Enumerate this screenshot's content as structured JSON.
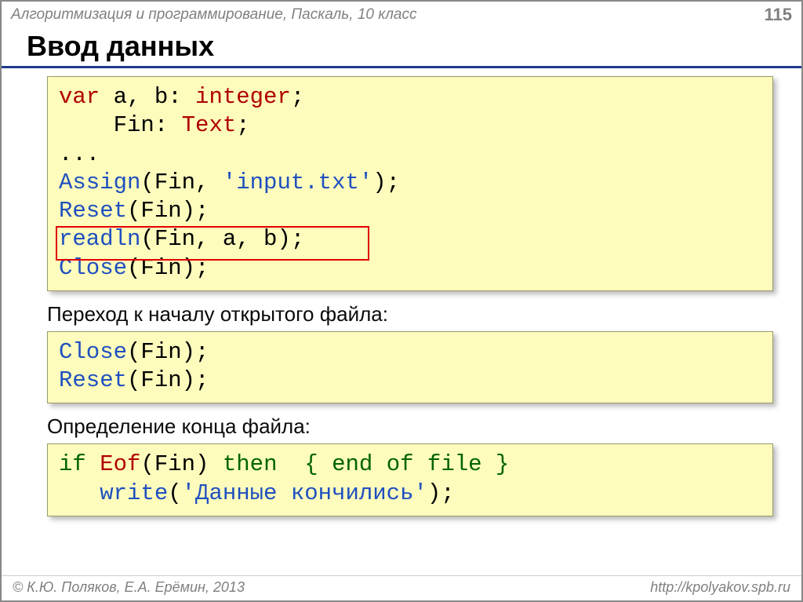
{
  "header": {
    "course": "Алгоритмизация и программирование, Паскаль, 10 класс",
    "page_number": "115"
  },
  "title": "Ввод данных",
  "code1": {
    "l1_var": "var",
    "l1_rest": " a, b: ",
    "l1_int": "integer",
    "l1_semi": ";",
    "l2_pad": "    Fin: ",
    "l2_text": "Text",
    "l2_semi": ";",
    "l3": "...",
    "l4_fn": "Assign",
    "l4_open": "(Fin, ",
    "l4_str": "'input.txt'",
    "l4_close": ");",
    "l5_fn": "Reset",
    "l5_rest": "(Fin);",
    "l6_fn": "readln",
    "l6_rest": "(Fin, a, b);",
    "l7_fn": "Close",
    "l7_rest": "(Fin);"
  },
  "caption1": "Переход к началу открытого файла:",
  "code2": {
    "l1_fn": "Close",
    "l1_rest": "(Fin);",
    "l2_fn": "Reset",
    "l2_rest": "(Fin);"
  },
  "caption2": "Определение конца файла:",
  "code3": {
    "l1_if": "if",
    "l1_sp1": " ",
    "l1_eof": "Eof",
    "l1_args": "(Fin) ",
    "l1_then": "then",
    "l1_sp2": "  ",
    "l1_cmt": "{ end of file }",
    "l2_pad": "   ",
    "l2_fn": "write",
    "l2_open": "(",
    "l2_str": "'Данные кончились'",
    "l2_close": ");"
  },
  "footer": {
    "authors": "© К.Ю. Поляков, Е.А. Ерёмин, 2013",
    "url": "http://kpolyakov.spb.ru"
  }
}
